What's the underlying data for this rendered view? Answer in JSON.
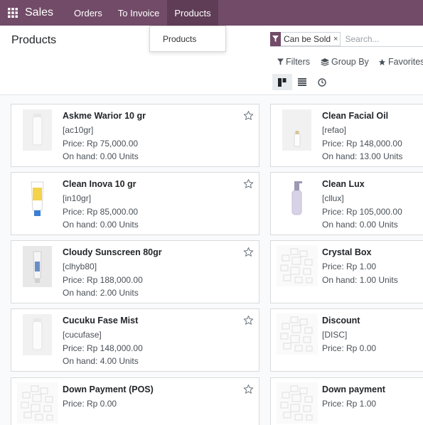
{
  "navbar": {
    "brand": "Sales",
    "menu": [
      "Orders",
      "To Invoice",
      "Products"
    ],
    "active_menu": "Products"
  },
  "dropdown": {
    "items": [
      "Products"
    ]
  },
  "control": {
    "title": "Products",
    "facet_label": "Can be Sold",
    "facet_remove": "×",
    "search_placeholder": "Search...",
    "filters_label": "Filters",
    "groupby_label": "Group By",
    "favorites_label": "Favorites"
  },
  "colors": {
    "brand": "#714b67",
    "brand_dark": "#5f3d56"
  },
  "products": [
    {
      "name": "Askme Warior 10 gr",
      "ref": "[ac10gr]",
      "price": "Price: Rp 75,000.00",
      "onhand": "On hand: 0.00 Units",
      "image": "white-bottle"
    },
    {
      "name": "Clean Facial Oil",
      "ref": "[refao]",
      "price": "Price: Rp 148,000.00",
      "onhand": "On hand: 13.00 Units",
      "image": "small-bottle"
    },
    {
      "name": "Clean Inova 10 gr",
      "ref": "[in10gr]",
      "price": "Price: Rp 85,000.00",
      "onhand": "On hand: 0.00 Units",
      "image": "yellow-tube"
    },
    {
      "name": "Clean Lux",
      "ref": "[cllux]",
      "price": "Price: Rp 105,000.00",
      "onhand": "On hand: 0.00 Units",
      "image": "pump-bottle"
    },
    {
      "name": "Cloudy Sunscreen 80gr",
      "ref": "[clhyb80]",
      "price": "Price: Rp 188,000.00",
      "onhand": "On hand: 2.00 Units",
      "image": "grey-tube"
    },
    {
      "name": "Crystal Box",
      "ref": "",
      "price": "Price: Rp 1.00",
      "onhand": "On hand: 1.00 Units",
      "image": "placeholder"
    },
    {
      "name": "Cucuku Fase Mist",
      "ref": "[cucufase]",
      "price": "Price: Rp 148,000.00",
      "onhand": "On hand: 4.00 Units",
      "image": "white-bottle"
    },
    {
      "name": "Discount",
      "ref": "[DISC]",
      "price": "Price: Rp 0.00",
      "onhand": "",
      "image": "placeholder"
    },
    {
      "name": "Down Payment (POS)",
      "ref": "",
      "price": "Price: Rp 0.00",
      "onhand": "",
      "image": "placeholder"
    },
    {
      "name": "Down payment",
      "ref": "",
      "price": "Price: Rp 1.00",
      "onhand": "",
      "image": "placeholder"
    }
  ]
}
